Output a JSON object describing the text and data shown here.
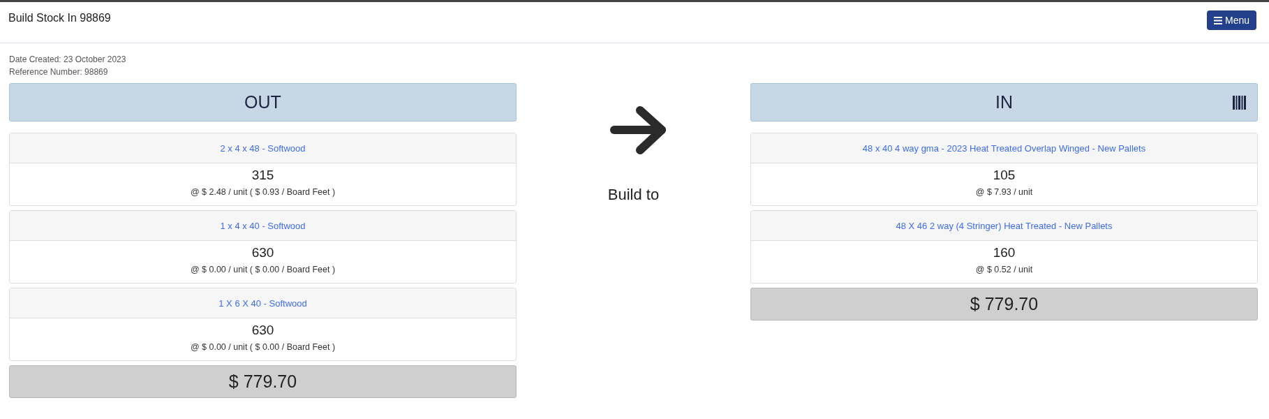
{
  "header": {
    "title": "Build Stock In 98869",
    "menu_label": "Menu"
  },
  "info_lines": [
    "Date Created: 23 October 2023",
    "Reference Number: 98869"
  ],
  "panels": [
    {
      "kind": "out",
      "title": "OUT",
      "items": [
        {
          "name": "2 x 4 x 48 - Softwood",
          "quantity": "315",
          "price": "@ $ 2.48 / unit ( $ 0.93 / Board Feet )"
        },
        {
          "name": "1 x 4 x 40 - Softwood",
          "quantity": "630",
          "price": "@ $ 0.00 / unit ( $ 0.00 / Board Feet )"
        },
        {
          "name": "1 X 6 X 40 - Softwood",
          "quantity": "630",
          "price": "@ $ 0.00 / unit ( $ 0.00 / Board Feet )"
        }
      ],
      "total": "$ 779.70"
    },
    {
      "kind": "in",
      "title": "IN",
      "items": [
        {
          "name": "48 x 40 4 way gma - 2023 Heat Treated Overlap Winged - New Pallets",
          "quantity": "105",
          "price": "@ $ 7.93 / unit"
        },
        {
          "name": "48 X 46 2 way (4 Stringer) Heat Treated - New Pallets",
          "quantity": "160",
          "price": "@ $ 0.52 / unit"
        }
      ],
      "total": "$ 779.70"
    }
  ],
  "middle": {
    "label": "Build to"
  }
}
